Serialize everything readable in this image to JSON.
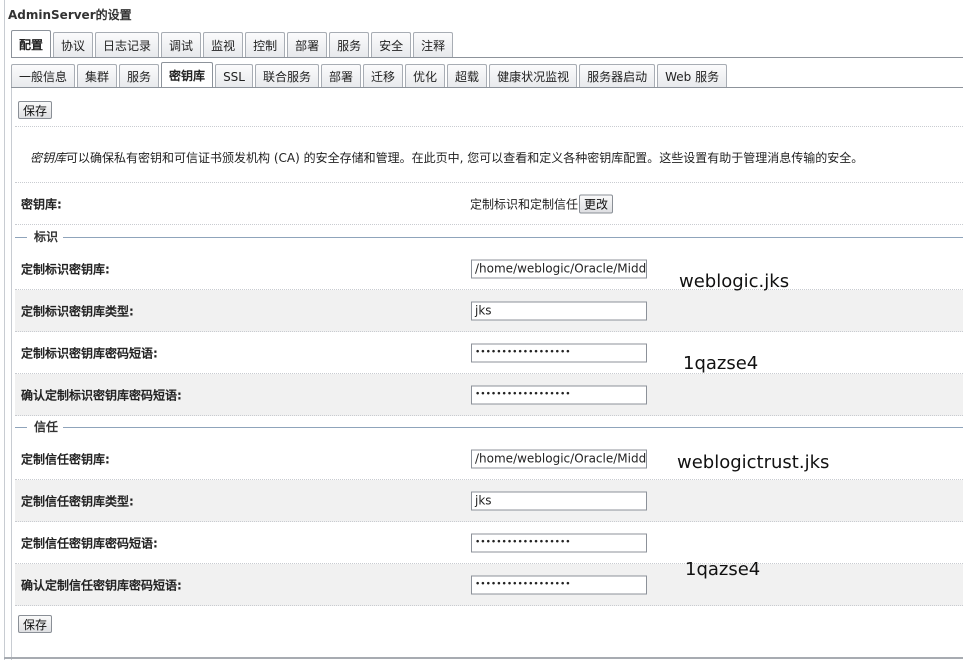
{
  "page": {
    "title": "AdminServer的设置"
  },
  "main_tabs": [
    {
      "label": "配置",
      "active": true
    },
    {
      "label": "协议",
      "active": false
    },
    {
      "label": "日志记录",
      "active": false
    },
    {
      "label": "调试",
      "active": false
    },
    {
      "label": "监视",
      "active": false
    },
    {
      "label": "控制",
      "active": false
    },
    {
      "label": "部署",
      "active": false
    },
    {
      "label": "服务",
      "active": false
    },
    {
      "label": "安全",
      "active": false
    },
    {
      "label": "注释",
      "active": false
    }
  ],
  "sub_tabs": [
    {
      "label": "一般信息",
      "active": false
    },
    {
      "label": "集群",
      "active": false
    },
    {
      "label": "服务",
      "active": false
    },
    {
      "label": "密钥库",
      "active": true
    },
    {
      "label": "SSL",
      "active": false
    },
    {
      "label": "联合服务",
      "active": false
    },
    {
      "label": "部署",
      "active": false
    },
    {
      "label": "迁移",
      "active": false
    },
    {
      "label": "优化",
      "active": false
    },
    {
      "label": "超载",
      "active": false
    },
    {
      "label": "健康状况监视",
      "active": false
    },
    {
      "label": "服务器启动",
      "active": false
    },
    {
      "label": "Web 服务",
      "active": false
    }
  ],
  "buttons": {
    "save_top": "保存",
    "save_bottom": "保存",
    "change": "更改"
  },
  "description": {
    "term": "密钥库",
    "text": "可以确保私有密钥和可信证书颁发机构 (CA) 的安全存储和管理。在此页中, 您可以查看和定义各种密钥库配置。这些设置有助于管理消息传输的安全。"
  },
  "keystore": {
    "label": "密钥库:",
    "value": "定制标识和定制信任"
  },
  "sections": {
    "identity": "标识",
    "trust": "信任"
  },
  "identity_rows": [
    {
      "label": "定制标识密钥库:",
      "value": "/home/weblogic/Oracle/Midd"
    },
    {
      "label": "定制标识密钥库类型:",
      "value": "jks"
    },
    {
      "label": "定制标识密钥库密码短语:",
      "value": "••••••••••••••••••"
    },
    {
      "label": "确认定制标识密钥库密码短语:",
      "value": "••••••••••••••••••"
    }
  ],
  "trust_rows": [
    {
      "label": "定制信任密钥库:",
      "value": "/home/weblogic/Oracle/Midd"
    },
    {
      "label": "定制信任密钥库类型:",
      "value": "jks"
    },
    {
      "label": "定制信任密钥库密码短语:",
      "value": "••••••••••••••••••"
    },
    {
      "label": "确认定制信任密钥库密码短语:",
      "value": "••••••••••••••••••"
    }
  ],
  "annotations": {
    "identity_file": "weblogic.jks",
    "identity_pass": "1qazse4",
    "trust_file": "weblogictrust.jks",
    "trust_pass": "1qazse4"
  }
}
